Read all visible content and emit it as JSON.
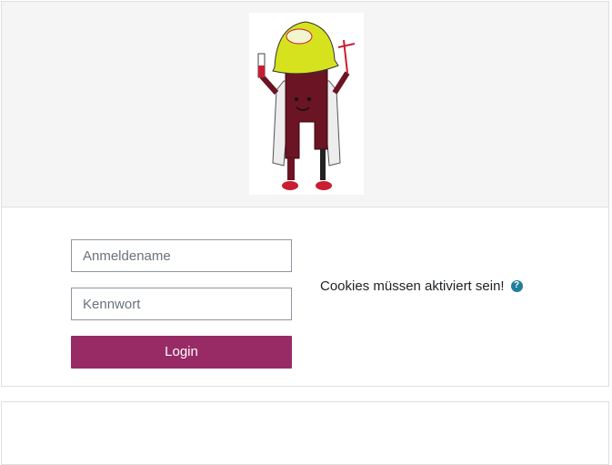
{
  "logo": {
    "alt": "Mascot logo with yellow helmet",
    "colors": {
      "helmet": "#d7e21f",
      "body": "#6b1423",
      "coat": "#e9e9e9",
      "boots": "#c91d32"
    }
  },
  "login": {
    "username_placeholder": "Anmeldename",
    "password_placeholder": "Kennwort",
    "login_label": "Login"
  },
  "cookies": {
    "text": "Cookies müssen aktiviert sein!",
    "help_icon": "question-circle-icon",
    "help_glyph": "?"
  },
  "colors": {
    "accent": "#982b65",
    "help": "#1f7e9a",
    "header_bg": "#f5f5f5"
  }
}
